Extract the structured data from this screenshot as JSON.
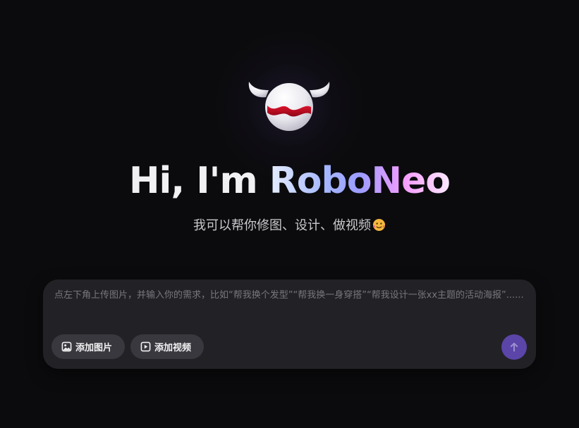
{
  "hero": {
    "greeting": "Hi, I'm ",
    "brand": "RoboNeo",
    "subtitle": "我可以帮你修图、设计、做视频"
  },
  "composer": {
    "placeholder": "点左下角上传图片，并输入你的需求，比如“帮我换个发型”“帮我换一身穿搭”“帮我设计一张xx主题的活动海报”......",
    "value": "",
    "add_image_label": "添加图片",
    "add_video_label": "添加视频"
  },
  "icons": {
    "add_image": "image-icon",
    "add_video": "play-icon",
    "send": "arrow-up-icon",
    "subtitle_emoji": "face-emoji-icon"
  },
  "colors": {
    "background": "#0b0b0d",
    "composer": "#222226",
    "chip": "#38383e",
    "send_button": "#5b45a8",
    "brand_gradient": [
      "#e6eeff",
      "#a6b9ff",
      "#9c9cff",
      "#f59cff",
      "#fde9ff"
    ]
  }
}
